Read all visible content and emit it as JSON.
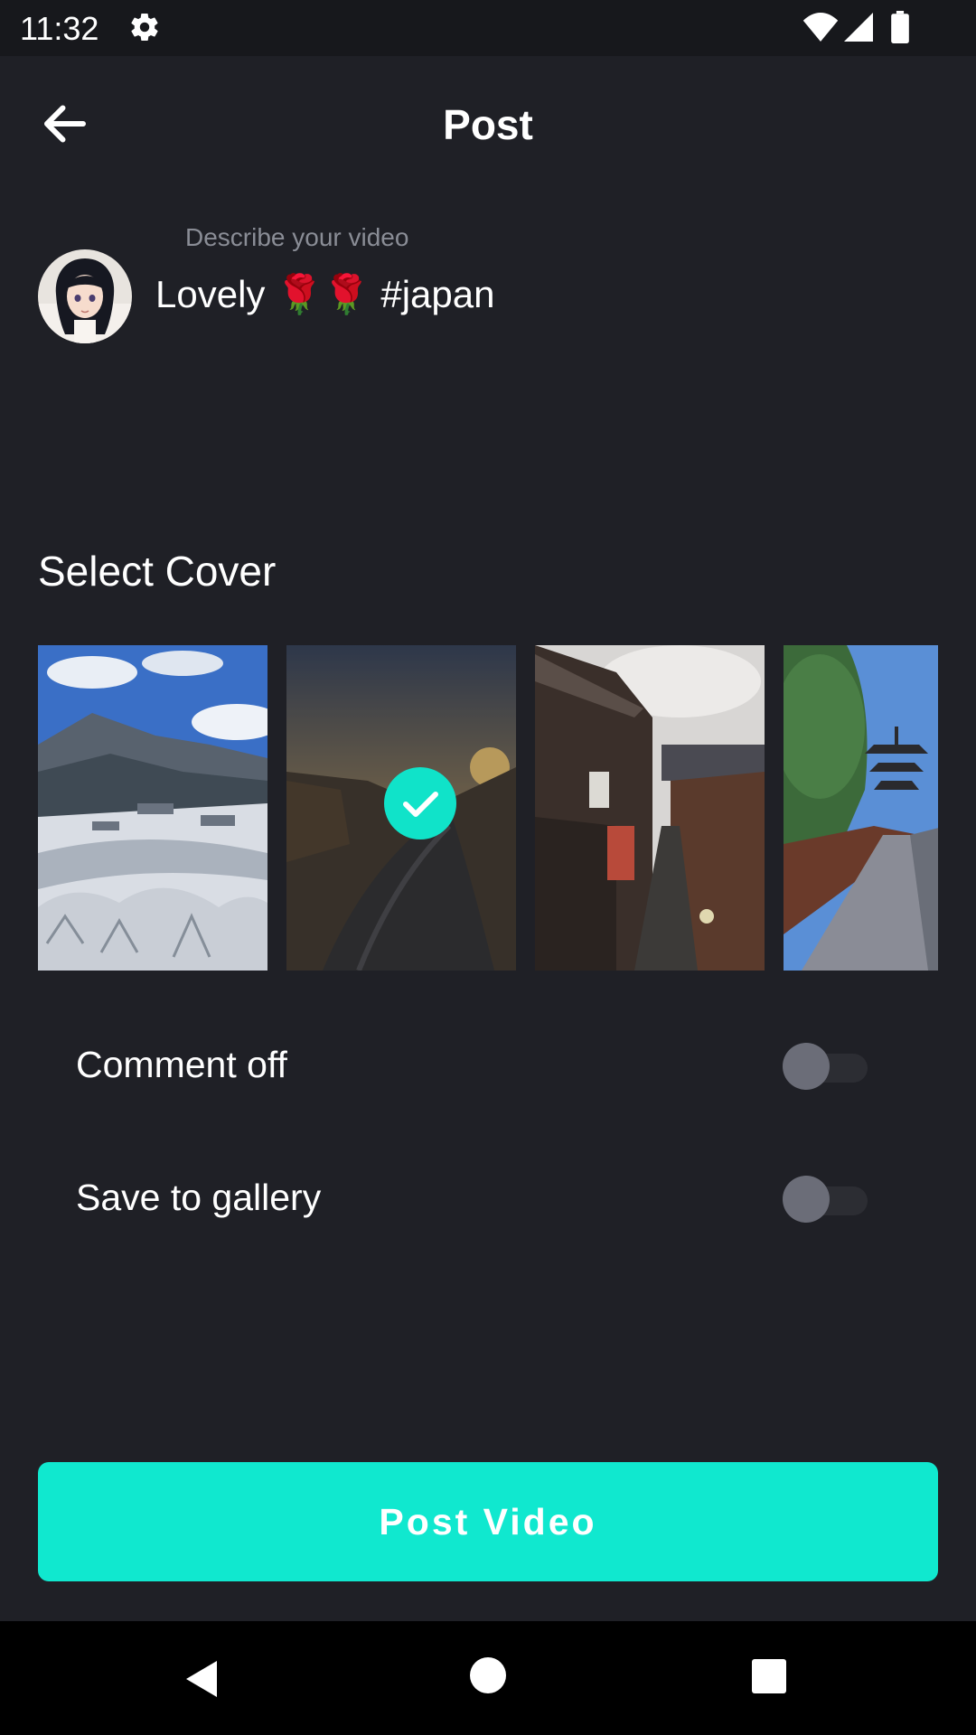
{
  "status_bar": {
    "time": "11:32",
    "icons": [
      "gear-icon",
      "wifi-icon",
      "signal-icon",
      "battery-icon"
    ]
  },
  "header": {
    "title": "Post",
    "back_icon": "arrow-left-icon"
  },
  "description": {
    "placeholder_label": "Describe your video",
    "text_before": "Lovely ",
    "emoji": "🌹🌹",
    "hashtag": " #japan"
  },
  "cover_section": {
    "title": "Select Cover",
    "covers": [
      {
        "name": "snowy-village",
        "selected": false
      },
      {
        "name": "sunset-path",
        "selected": true
      },
      {
        "name": "old-street",
        "selected": false
      },
      {
        "name": "pagoda-street",
        "selected": false
      }
    ]
  },
  "options": [
    {
      "label": "Comment off",
      "enabled": false
    },
    {
      "label": "Save to gallery",
      "enabled": false
    }
  ],
  "post_button": {
    "label": "Post Video"
  },
  "colors": {
    "background": "#1f2026",
    "accent": "#10e8cf",
    "toggle_off_thumb": "#6b6d78"
  },
  "nav_bar": [
    "nav-back-icon",
    "nav-home-icon",
    "nav-recents-icon"
  ]
}
